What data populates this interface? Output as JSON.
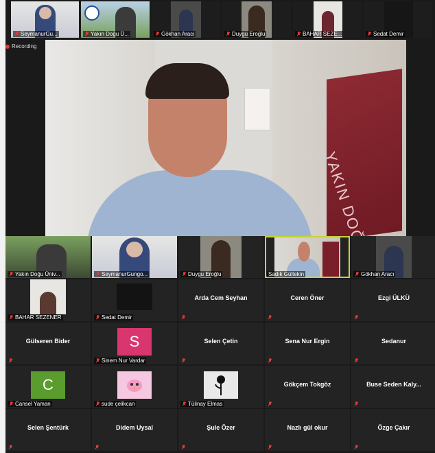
{
  "top_strip": [
    {
      "name": "SeymanurGu..."
    },
    {
      "name": "Yakın Doğu Ü..."
    },
    {
      "name": "Gökhan Aracı"
    },
    {
      "name": "Duygu Eroğlu"
    },
    {
      "name": "BAHAR SEZE..."
    },
    {
      "name": "Sedat Demir"
    }
  ],
  "recording_label": "Recording",
  "speaker": {
    "flag_text": "YAKIN DOĞU ÜNİV"
  },
  "grid": [
    [
      {
        "name": "Yakın Doğu Üniv..."
      },
      {
        "name": "SeymanurGungo..."
      },
      {
        "name": "Duygu Eroğlu"
      },
      {
        "name": "Sadık Gültekin"
      },
      {
        "name": "Gökhan Aracı"
      }
    ],
    [
      {
        "name": "BAHAR SEZENER"
      },
      {
        "name": "Sedat Demir"
      },
      {
        "name": "Arda Cem Seyhan"
      },
      {
        "name": "Ceren Öner"
      },
      {
        "name": "Ezgi ÜLKÜ"
      }
    ],
    [
      {
        "name": "Gülseren Bider"
      },
      {
        "name": "Sinem Nur Vardar",
        "avatar_letter": "S"
      },
      {
        "name": "Selen Çetin"
      },
      {
        "name": "Sena Nur Ergin"
      },
      {
        "name": "Sedanur"
      }
    ],
    [
      {
        "name": "Cansel Yaman",
        "avatar_letter": "C"
      },
      {
        "name": "sude çelikcan"
      },
      {
        "name": "Tülinay Elmas"
      },
      {
        "name": "Gökçem Tokgöz"
      },
      {
        "name": "Buse Seden Kaly..."
      }
    ],
    [
      {
        "name": "Selen Şentürk"
      },
      {
        "name": "Didem Uysal"
      },
      {
        "name": "Şule Özer"
      },
      {
        "name": "Nazlı gül okur"
      },
      {
        "name": "Özge Çakır"
      }
    ]
  ],
  "colors": {
    "muted": "#e0383b",
    "active_border": "#c6d435",
    "sinem_avatar": "#d9356e",
    "cansel_avatar": "#5a9c2d"
  }
}
